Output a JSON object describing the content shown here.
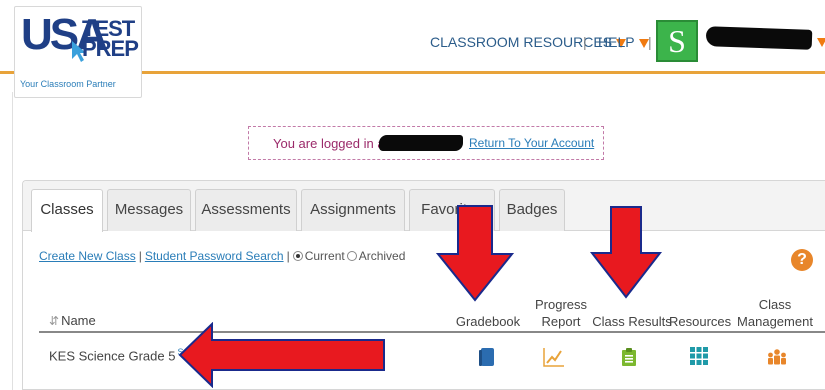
{
  "header": {
    "logo": {
      "line1": "USA",
      "line2": "TEST",
      "line3": "PREP",
      "tagline": "Your Classroom Partner"
    },
    "nav": {
      "classroom_resources": "CLASSROOM RESOURCES",
      "help": "HELP",
      "separator": "|"
    },
    "avatar_letter": "S"
  },
  "login_bar": {
    "text": "You are logged in as",
    "return_link": "Return To Your Account"
  },
  "tabs": [
    "Classes",
    "Messages",
    "Assessments",
    "Assignments",
    "Favorites",
    "Badges"
  ],
  "active_tab": "Classes",
  "class_links": {
    "create": "Create New Class",
    "sep": "|",
    "password_search": "Student Password Search",
    "current": "Current",
    "archived": "Archived"
  },
  "help_badge": "?",
  "table": {
    "columns": {
      "name": "Name",
      "gradebook": "Gradebook",
      "progress_1": "Progress",
      "progress_2": "Report",
      "class_results": "Class Results",
      "resources": "Resources",
      "management_1": "Class",
      "management_2": "Management"
    },
    "rows": [
      {
        "name": "KES Science Grade 5",
        "badge": "S"
      }
    ]
  },
  "icons": {
    "gradebook": "book-icon",
    "progress": "line-chart-icon",
    "results": "clipboard-icon",
    "resources": "grid-icon",
    "management": "people-icon"
  },
  "colors": {
    "brand_blue": "#1f3f86",
    "accent_orange": "#e8a33a",
    "link_blue": "#2a7db8",
    "annotation_red": "#e8191f",
    "annotation_outline": "#1a2a8c"
  }
}
